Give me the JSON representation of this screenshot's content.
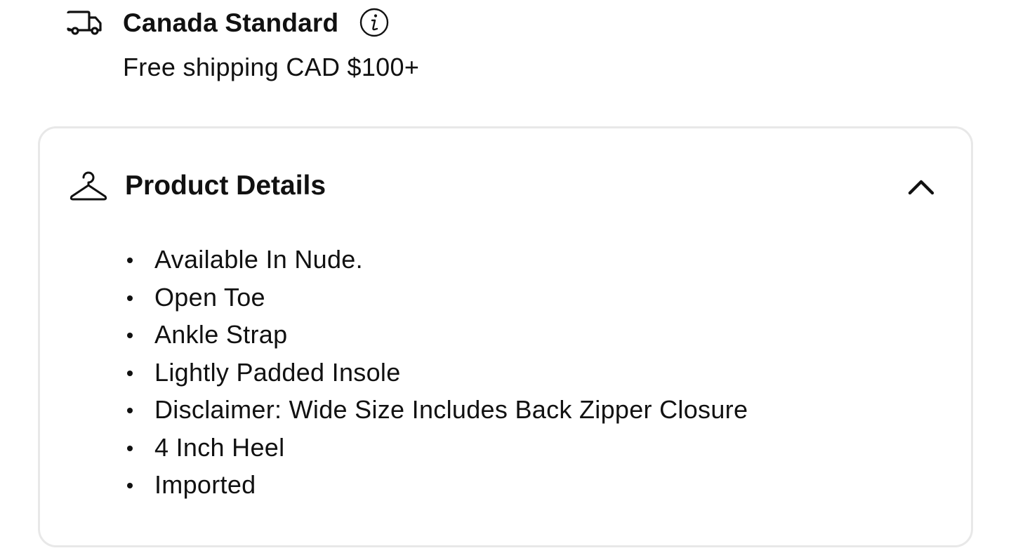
{
  "shipping": {
    "icon": "truck-icon",
    "title": "Canada Standard",
    "info_icon": "info-icon",
    "subtitle": "Free shipping CAD $100+"
  },
  "product_details": {
    "icon": "hanger-icon",
    "title": "Product Details",
    "toggle_icon": "chevron-up-icon",
    "expanded": true,
    "items": [
      "Available In Nude.",
      "Open Toe",
      "Ankle Strap",
      "Lightly Padded Insole",
      "Disclaimer: Wide Size Includes Back Zipper Closure",
      "4 Inch Heel",
      "Imported"
    ]
  }
}
